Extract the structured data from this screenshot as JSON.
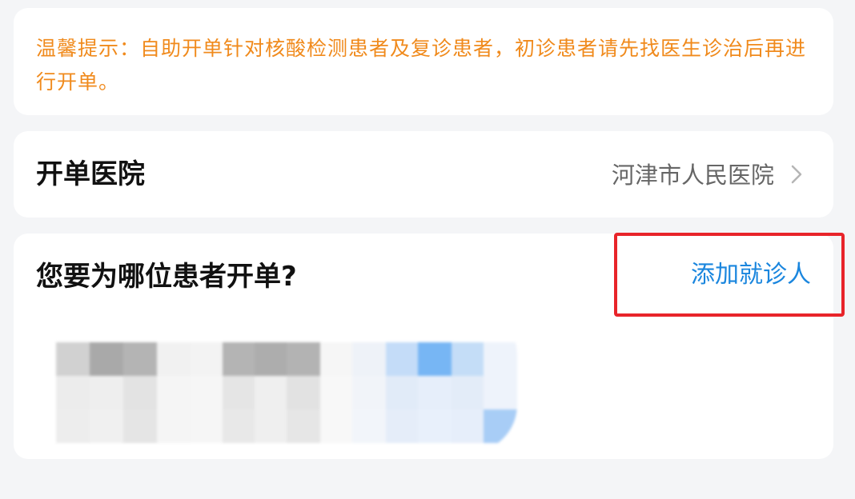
{
  "tip": {
    "text": "温馨提示：自助开单针对核酸检测患者及复诊患者，初诊患者请先找医生诊治后再进行开单。"
  },
  "hospital": {
    "label": "开单医院",
    "value": "河津市人民医院"
  },
  "patient_section": {
    "title": "您要为哪位患者开单?",
    "add_label": "添加就诊人"
  },
  "colors": {
    "tip": "#f08a1c",
    "link": "#1a86de",
    "highlight": "#e8242a",
    "background": "#f4f5f7"
  }
}
